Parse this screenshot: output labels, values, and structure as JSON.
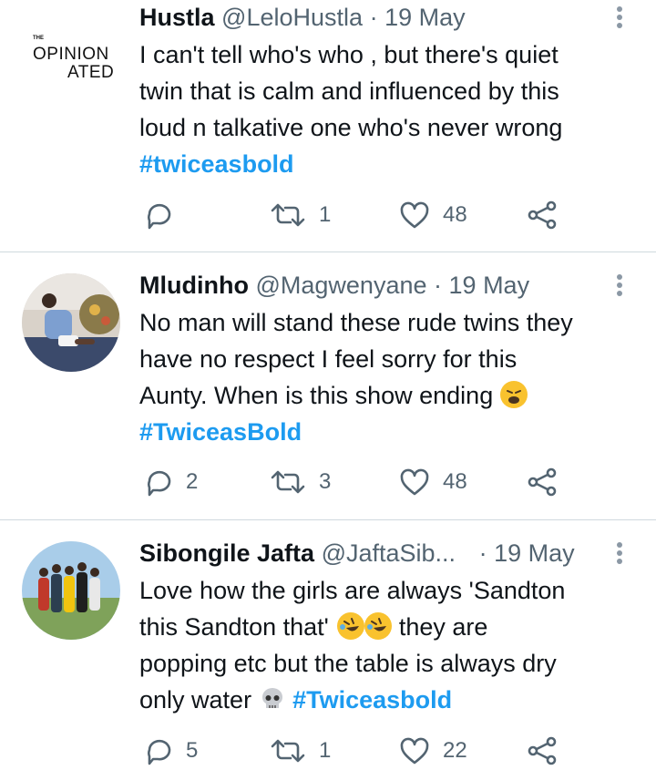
{
  "tweets": [
    {
      "avatar_text": {
        "top": "OPINION",
        "bottom": "ATED"
      },
      "name": "Hustla",
      "handle": "@LeloHustla",
      "separator": "·",
      "date": "19 May",
      "text_lines": [
        "I can't tell who's who , but there's quiet",
        "twin that is calm and influenced by this",
        "loud n talkative one who's never wrong"
      ],
      "hashtag": "#twiceasbold",
      "replies": "",
      "retweets": "1",
      "likes": "48"
    },
    {
      "name": "Mludinho",
      "handle": "@Magwenyane",
      "separator": "·",
      "date": "19 May",
      "text_lines": [
        "No man will stand these rude twins they",
        "have no respect I feel sorry for this",
        "Aunty. When is this show ending"
      ],
      "emoji": "weary-face",
      "hashtag": "#TwiceasBold",
      "replies": "2",
      "retweets": "3",
      "likes": "48"
    },
    {
      "name": "Sibongile Jafta",
      "handle": "@JaftaSib...",
      "separator": "·",
      "date": "19 May",
      "text_lines": [
        "Love how the girls are always 'Sandton",
        "this Sandton that'",
        "they are",
        "popping etc but the table is always dry",
        "only water"
      ],
      "emojis": [
        "rolling-laughing-face",
        "rolling-laughing-face",
        "skull"
      ],
      "hashtag": "#Twiceasbold",
      "replies": "5",
      "retweets": "1",
      "likes": "22"
    }
  ],
  "colors": {
    "text": "#0f1419",
    "secondary": "#536471",
    "hashtag": "#1d9bf0",
    "divider": "#cfd9de"
  }
}
